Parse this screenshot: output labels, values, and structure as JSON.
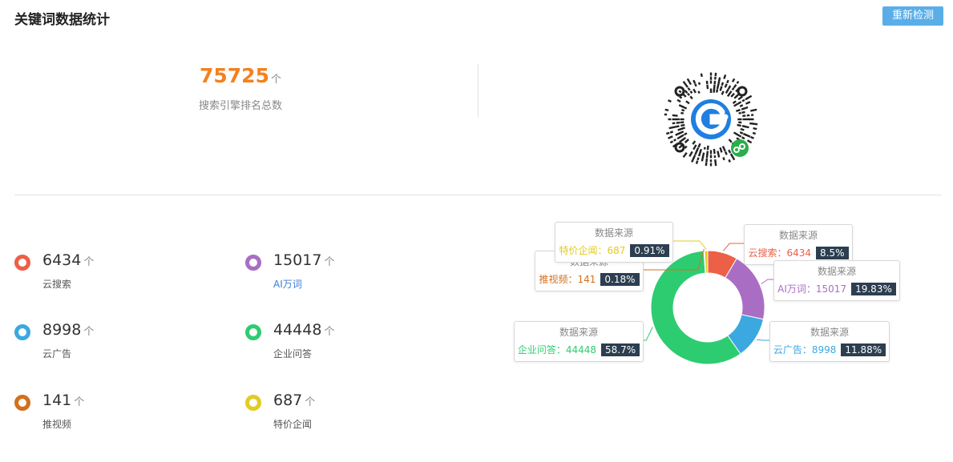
{
  "header": {
    "title": "关键词数据统计",
    "recheck_label": "重新检测"
  },
  "summary": {
    "total": "75725",
    "unit": "个",
    "label": "搜索引擎排名总数"
  },
  "qr": {
    "icon": "mini-program-qr-code"
  },
  "stats": [
    {
      "value": "6434",
      "unit": "个",
      "label": "云搜索",
      "color": "#eb6047"
    },
    {
      "value": "15017",
      "unit": "个",
      "label": "AI万词",
      "color": "#a96ec4"
    },
    {
      "value": "8998",
      "unit": "个",
      "label": "云广告",
      "color": "#3ba8e0"
    },
    {
      "value": "44448",
      "unit": "个",
      "label": "企业问答",
      "color": "#2ecc71"
    },
    {
      "value": "141",
      "unit": "个",
      "label": "推视频",
      "color": "#d36f1c"
    },
    {
      "value": "687",
      "unit": "个",
      "label": "特价企闻",
      "color": "#e2cb24"
    }
  ],
  "chart_data": {
    "type": "pie",
    "donut": true,
    "tooltip_title": "数据来源",
    "slices": [
      {
        "name": "云搜索",
        "value": 6434,
        "percent": "8.5%",
        "color": "#eb6047"
      },
      {
        "name": "AI万词",
        "value": 15017,
        "percent": "19.83%",
        "color": "#a96ec4"
      },
      {
        "name": "云广告",
        "value": 8998,
        "percent": "11.88%",
        "color": "#3ba8e0"
      },
      {
        "name": "企业问答",
        "value": 44448,
        "percent": "58.7%",
        "color": "#2ecc71"
      },
      {
        "name": "推视频",
        "value": 141,
        "percent": "0.18%",
        "color": "#d36f1c"
      },
      {
        "name": "特价企闻",
        "value": 687,
        "percent": "0.91%",
        "color": "#e2cb24"
      }
    ]
  }
}
